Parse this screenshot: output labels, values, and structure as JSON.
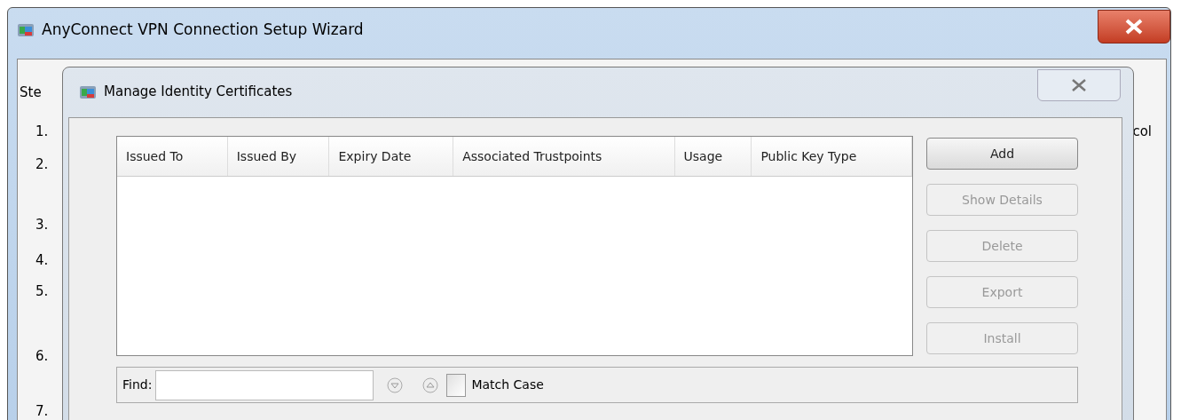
{
  "wizard": {
    "title": "AnyConnect VPN Connection Setup Wizard",
    "steps_header": "Ste",
    "steps": [
      "1.",
      "2.",
      "3.",
      "4.",
      "5.",
      "6.",
      "7."
    ],
    "right_text": "col"
  },
  "dialog": {
    "title": "Manage Identity Certificates",
    "table": {
      "columns": [
        "Issued To",
        "Issued By",
        "Expiry Date",
        "Associated Trustpoints",
        "Usage",
        "Public Key Type"
      ]
    },
    "buttons": [
      {
        "label": "Add",
        "disabled": false
      },
      {
        "label": "Show Details",
        "disabled": true
      },
      {
        "label": "Delete",
        "disabled": true
      },
      {
        "label": "Export",
        "disabled": true
      },
      {
        "label": "Install",
        "disabled": true
      }
    ],
    "find": {
      "label": "Find:"
    },
    "match_case": {
      "label": "Match Case",
      "checked": false
    }
  }
}
